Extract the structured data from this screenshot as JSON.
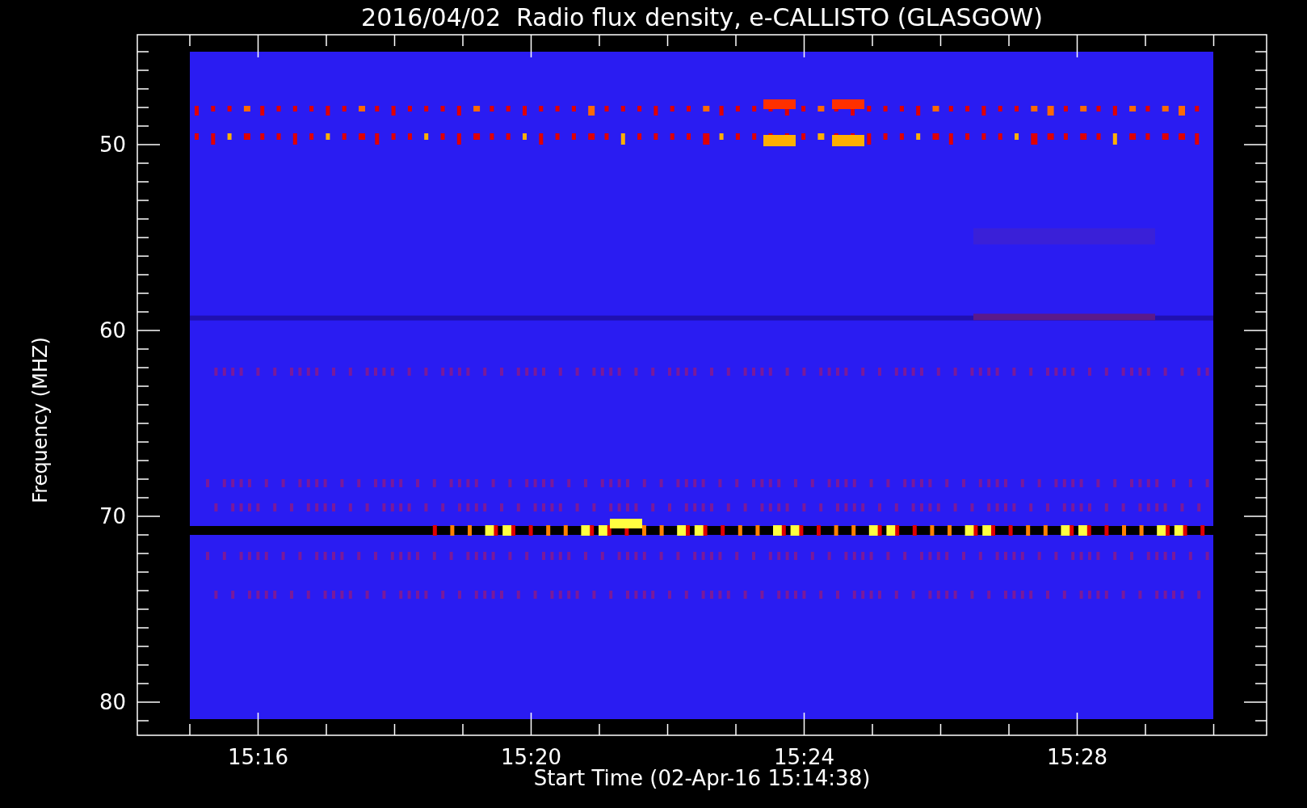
{
  "title": "2016/04/02  Radio flux density, e-CALLISTO (GLASGOW)",
  "y_axis": {
    "label": "Frequency (MHZ)",
    "ticks": [
      "50",
      "60",
      "70",
      "80"
    ]
  },
  "x_axis": {
    "label": "Start Time (02-Apr-16 15:14:38)",
    "ticks": [
      "15:16",
      "15:20",
      "15:24",
      "15:28"
    ]
  }
}
